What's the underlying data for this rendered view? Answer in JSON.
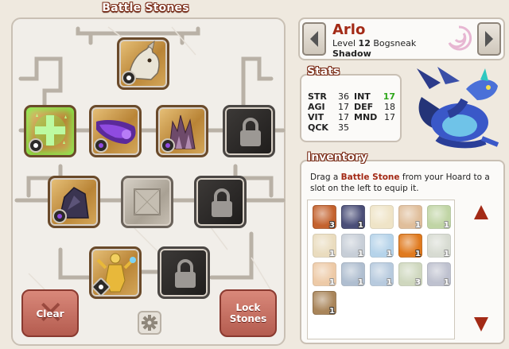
{
  "battle_stones": {
    "title": "Battle Stones",
    "slots": [
      {
        "id": "top",
        "state": "filled",
        "stone": "dragon-head-stone",
        "socket": "white",
        "style": "gold"
      },
      {
        "id": "r2-1",
        "state": "filled",
        "stone": "green-cross-stone",
        "socket": "white",
        "style": "gold"
      },
      {
        "id": "r2-2",
        "state": "filled",
        "stone": "purple-comet-stone",
        "socket": "purple",
        "style": "gold"
      },
      {
        "id": "r2-3",
        "state": "filled",
        "stone": "purple-crystal-stone",
        "socket": "purple",
        "style": "gold"
      },
      {
        "id": "r2-4",
        "state": "locked",
        "style": "dark"
      },
      {
        "id": "r3-1",
        "state": "filled",
        "stone": "dark-rock-stone",
        "socket": "purple",
        "style": "gold"
      },
      {
        "id": "r3-2",
        "state": "empty",
        "style": "gray"
      },
      {
        "id": "r3-3",
        "state": "locked",
        "style": "dark"
      },
      {
        "id": "r4-1",
        "state": "filled",
        "stone": "golden-statue-stone",
        "socket": "diamond",
        "style": "gold"
      },
      {
        "id": "r4-2",
        "state": "locked",
        "style": "dark"
      }
    ],
    "clear_label": "Clear",
    "lock_label_1": "Lock",
    "lock_label_2": "Stones"
  },
  "character": {
    "name": "Arlo",
    "level_prefix": "Level",
    "level": "12",
    "species": "Bogsneak",
    "element": "Shadow"
  },
  "stats": {
    "title": "Stats",
    "items": [
      {
        "key": "STR",
        "value": "36"
      },
      {
        "key": "INT",
        "value": "17",
        "highlight": true
      },
      {
        "key": "AGI",
        "value": "17"
      },
      {
        "key": "DEF",
        "value": "18"
      },
      {
        "key": "VIT",
        "value": "17"
      },
      {
        "key": "MND",
        "value": "17"
      },
      {
        "key": "QCK",
        "value": "35"
      }
    ]
  },
  "inventory": {
    "title": "Inventory",
    "desc_1": "Drag a ",
    "desc_highlight": "Battle Stone",
    "desc_2": " from your Hoard to a slot on the left to equip it.",
    "items": [
      {
        "count": "3",
        "color": "#c4622e",
        "faded": false
      },
      {
        "count": "1",
        "color": "#4a4e78",
        "faded": false
      },
      {
        "count": "",
        "color": "#e3cf9a",
        "faded": true
      },
      {
        "count": "1",
        "color": "#c78a4a",
        "faded": true
      },
      {
        "count": "1",
        "color": "#8eb35c",
        "faded": true
      },
      {
        "count": "1",
        "color": "#d9c08a",
        "faded": true
      },
      {
        "count": "1",
        "color": "#9aa7b8",
        "faded": true
      },
      {
        "count": "1",
        "color": "#7ab0d9",
        "faded": true
      },
      {
        "count": "1",
        "color": "#e07a1e",
        "faded": false
      },
      {
        "count": "1",
        "color": "#b8bfae",
        "faded": true
      },
      {
        "count": "1",
        "color": "#e0a060",
        "faded": true
      },
      {
        "count": "1",
        "color": "#6f8aaa",
        "faded": true
      },
      {
        "count": "1",
        "color": "#7da0c4",
        "faded": true
      },
      {
        "count": "3",
        "color": "#a8b88a",
        "faded": true
      },
      {
        "count": "1",
        "color": "#8a8fa8",
        "faded": true
      },
      {
        "count": "1",
        "color": "#a9855a",
        "faded": false
      }
    ]
  }
}
